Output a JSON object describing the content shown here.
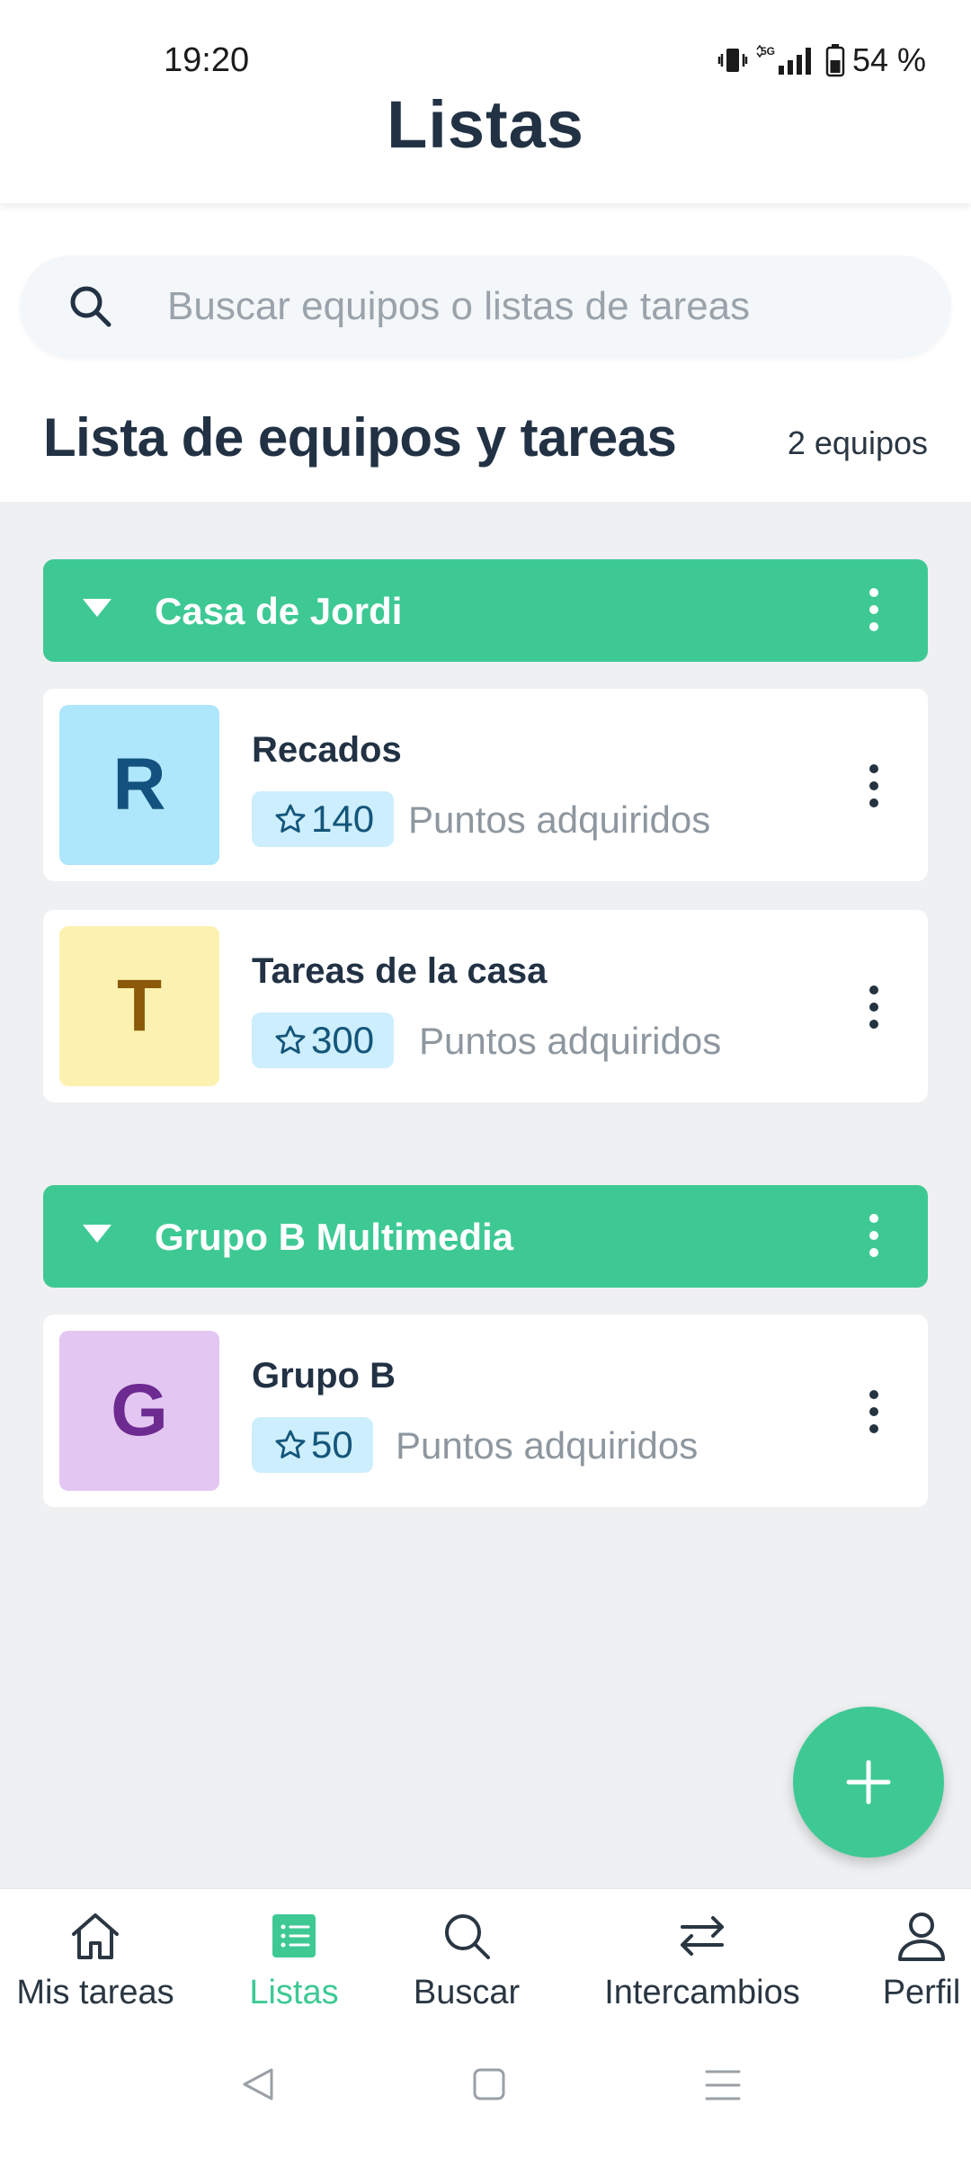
{
  "status_bar": {
    "time": "19:20",
    "network": "5G",
    "battery": "54 %",
    "icons": [
      "vibrate-icon",
      "signal-icon",
      "battery-icon"
    ]
  },
  "header": {
    "title": "Listas"
  },
  "search": {
    "placeholder": "Buscar equipos o listas de tareas",
    "icon": "search-icon"
  },
  "section": {
    "title": "Lista de equipos y tareas",
    "count": "2 equipos"
  },
  "groups": [
    {
      "name": "Casa de Jordi",
      "lists": [
        {
          "initial": "R",
          "name": "Recados",
          "points": "140",
          "points_label": "Puntos adquiridos",
          "avatar_bg": "#aee6fb",
          "avatar_fg": "#13527e"
        },
        {
          "initial": "T",
          "name": "Tareas de la casa",
          "points": "300",
          "points_label": "Puntos adquiridos",
          "avatar_bg": "#fdf1b1",
          "avatar_fg": "#8a5a0a"
        }
      ]
    },
    {
      "name": "Grupo B Multimedia",
      "lists": [
        {
          "initial": "G",
          "name": "Grupo B",
          "points": "50",
          "points_label": "Puntos adquiridos",
          "avatar_bg": "#e3c6f1",
          "avatar_fg": "#6d2a91"
        }
      ]
    }
  ],
  "fab": {
    "icon": "plus-icon"
  },
  "bottom_nav": [
    {
      "label": "Mis tareas",
      "icon": "home-icon",
      "active": false
    },
    {
      "label": "Listas",
      "icon": "list-icon",
      "active": true
    },
    {
      "label": "Buscar",
      "icon": "search-icon",
      "active": false
    },
    {
      "label": "Intercambios",
      "icon": "swap-icon",
      "active": false
    },
    {
      "label": "Perfil",
      "icon": "person-icon",
      "active": false
    }
  ],
  "colors": {
    "accent": "#3ec994",
    "title": "#223244",
    "content_bg": "#eef0f2",
    "badge_bg": "#cdeefd"
  }
}
